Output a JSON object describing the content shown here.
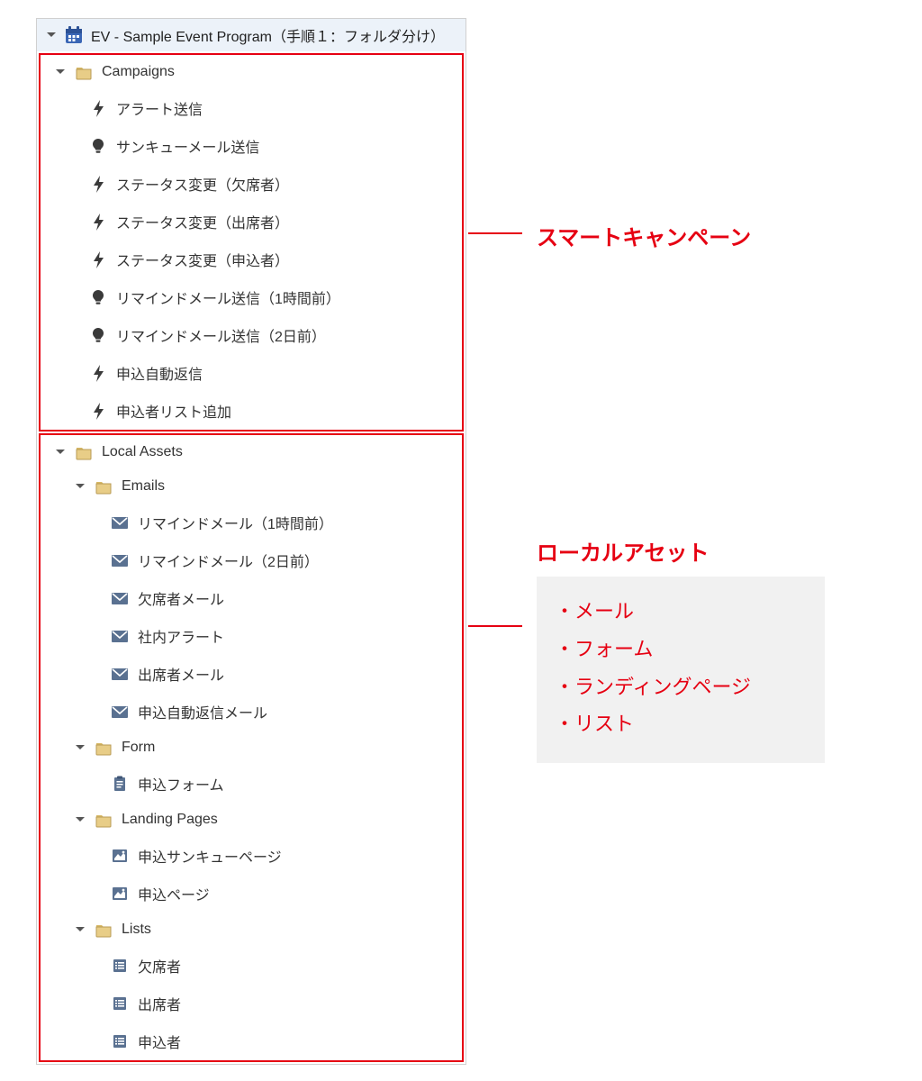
{
  "program": {
    "title": "EV - Sample Event Program（手順１：フォルダ分け）"
  },
  "campaigns": {
    "folder_label": "Campaigns",
    "items": [
      {
        "icon": "bolt",
        "label": "アラート送信"
      },
      {
        "icon": "bulb",
        "label": "サンキューメール送信"
      },
      {
        "icon": "bolt",
        "label": "ステータス変更（欠席者）"
      },
      {
        "icon": "bolt",
        "label": "ステータス変更（出席者）"
      },
      {
        "icon": "bolt",
        "label": "ステータス変更（申込者）"
      },
      {
        "icon": "bulb",
        "label": "リマインドメール送信（1時間前）"
      },
      {
        "icon": "bulb",
        "label": "リマインドメール送信（2日前）"
      },
      {
        "icon": "bolt",
        "label": "申込自動返信"
      },
      {
        "icon": "bolt",
        "label": "申込者リスト追加"
      }
    ]
  },
  "local_assets": {
    "folder_label": "Local Assets",
    "emails": {
      "folder_label": "Emails",
      "items": [
        "リマインドメール（1時間前）",
        "リマインドメール（2日前）",
        "欠席者メール",
        "社内アラート",
        "出席者メール",
        "申込自動返信メール"
      ]
    },
    "form": {
      "folder_label": "Form",
      "items": [
        "申込フォーム"
      ]
    },
    "landing_pages": {
      "folder_label": "Landing Pages",
      "items": [
        "申込サンキューページ",
        "申込ページ"
      ]
    },
    "lists": {
      "folder_label": "Lists",
      "items": [
        "欠席者",
        "出席者",
        "申込者"
      ]
    }
  },
  "annotations": {
    "smart_campaign": "スマートキャンペーン",
    "local_asset": "ローカルアセット",
    "bullets": [
      "・メール",
      "・フォーム",
      "・ランディングページ",
      "・リスト"
    ]
  }
}
